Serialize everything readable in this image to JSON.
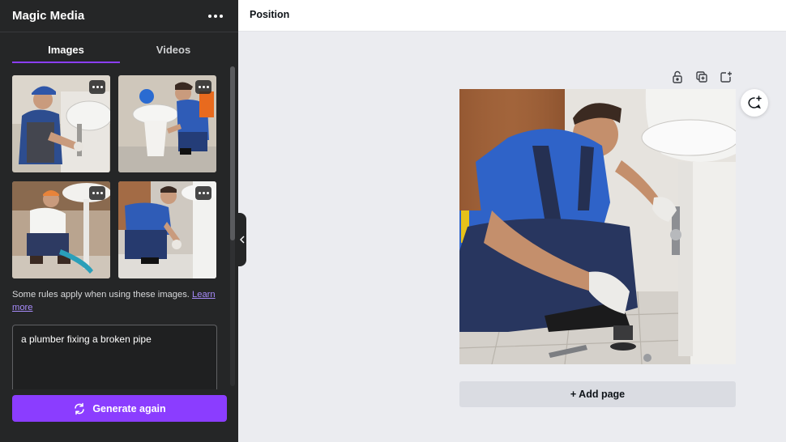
{
  "panel": {
    "title": "Magic Media",
    "more_icon": "more-horizontal-icon",
    "tabs": [
      {
        "label": "Images",
        "active": true
      },
      {
        "label": "Videos",
        "active": false
      }
    ],
    "rules_text": "Some rules apply when using these images.",
    "learn_more": "Learn more",
    "prompt": "a plumber fixing a broken pipe",
    "generate_label": "Generate again",
    "generate_icon": "refresh-icon"
  },
  "topbar": {
    "position_label": "Position"
  },
  "canvas": {
    "tool_icons": [
      "lock-icon",
      "duplicate-icon",
      "add-page-icon"
    ],
    "comment_icon": "add-comment-icon",
    "add_page_label": "+ Add page"
  },
  "colors": {
    "accent": "#8b3dff",
    "panel_bg": "#252627",
    "canvas_bg": "#ebecf0"
  }
}
